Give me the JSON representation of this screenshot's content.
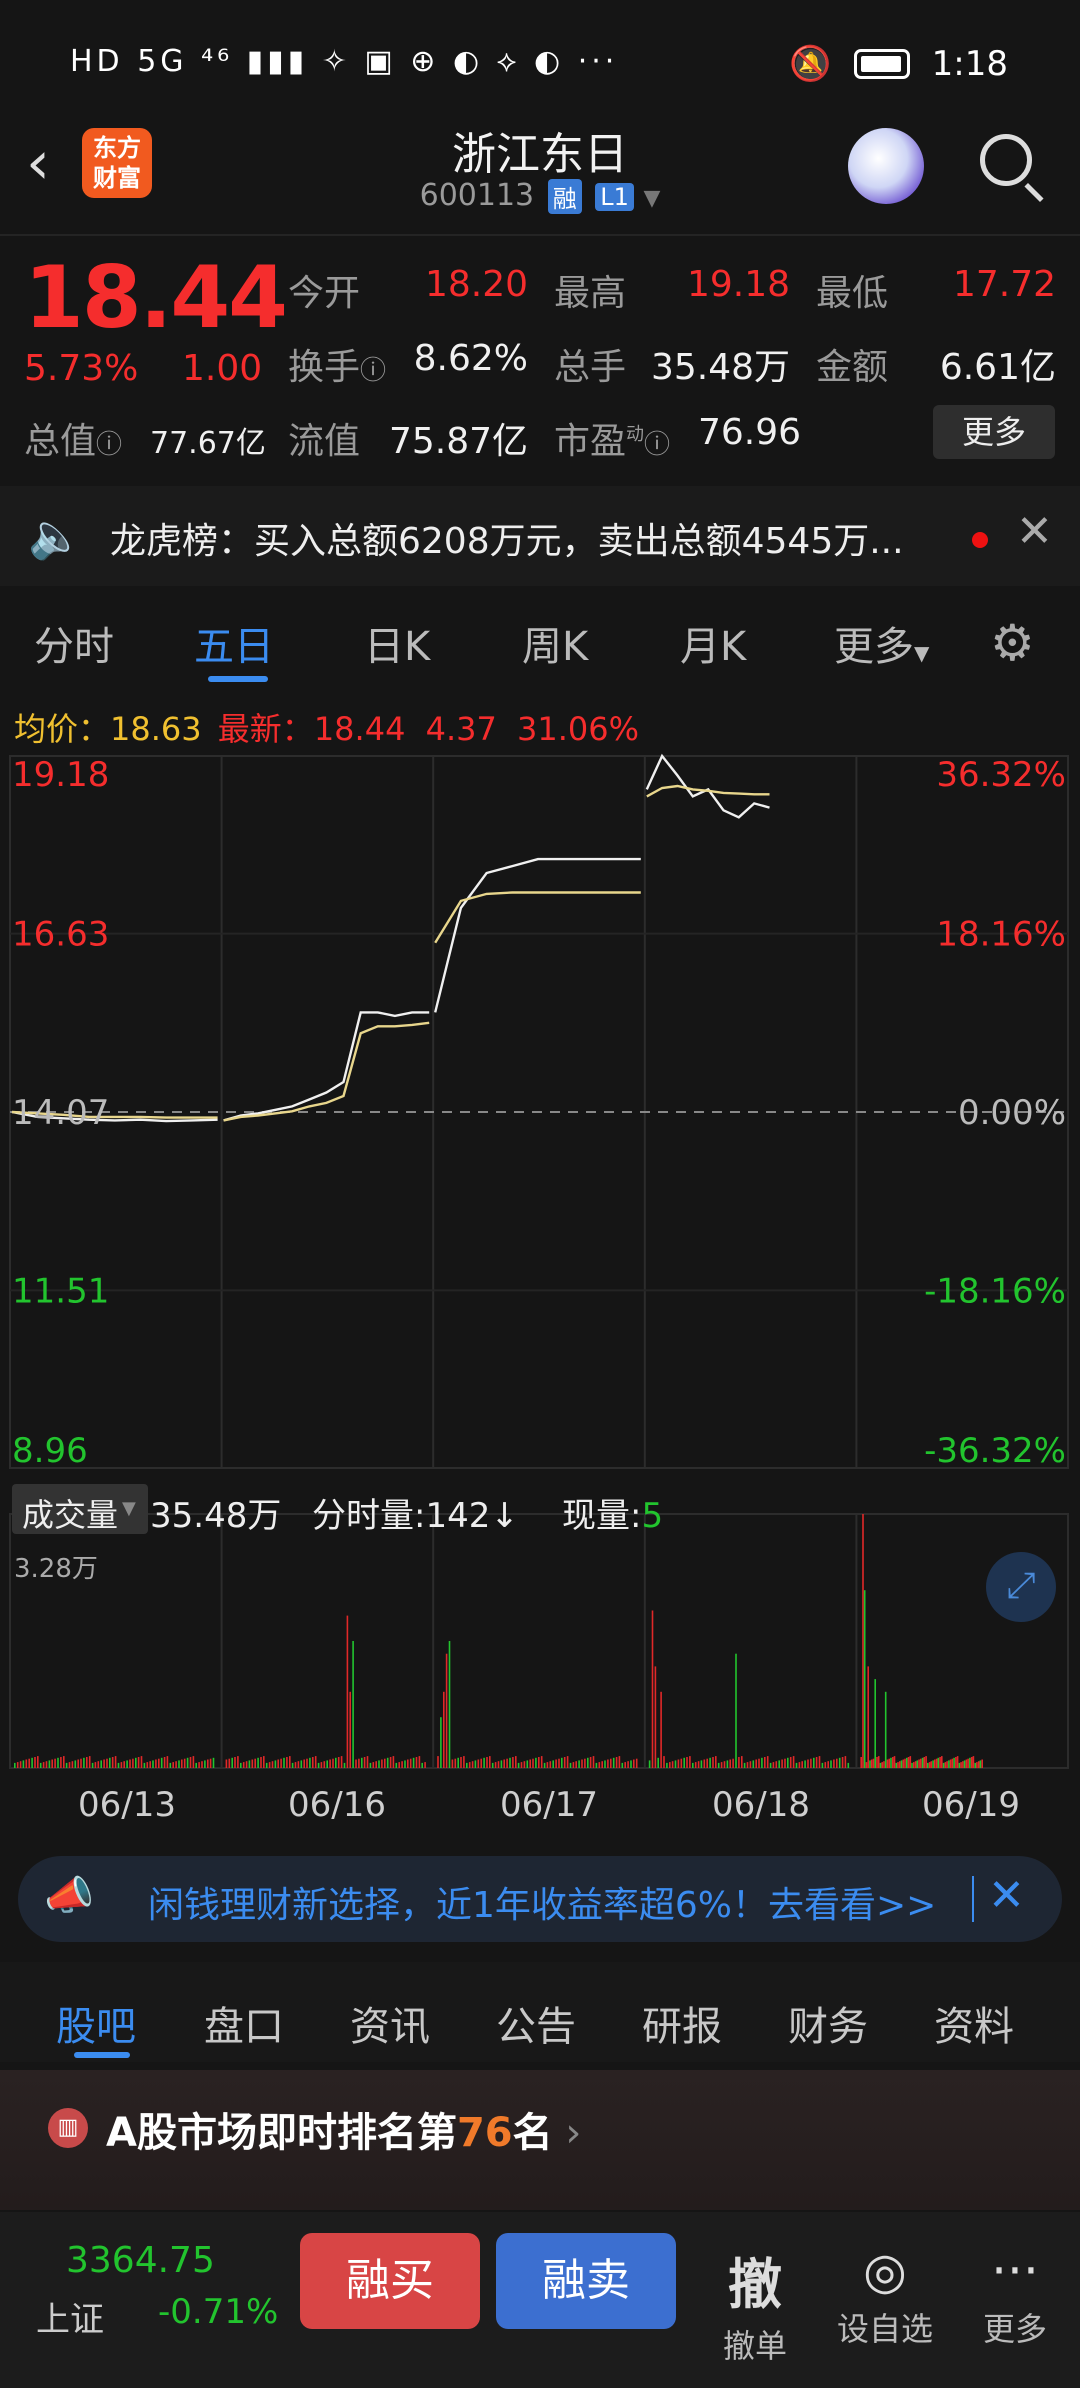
{
  "status": {
    "left": "HD 5G ⁴⁶ ▮▮▮ ✧ ▣ ⊕ ◐ ⟡ ◐ ···",
    "time": "1:18"
  },
  "header": {
    "logo_line1": "东方",
    "logo_line2": "财富",
    "title": "浙江东日",
    "code": "600113",
    "tag1": "融",
    "tag2": "L1"
  },
  "quote": {
    "price": "18.44",
    "pct": "5.73%",
    "change": "1.00",
    "open_label": "今开",
    "open": "18.20",
    "high_label": "最高",
    "high": "19.18",
    "low_label": "最低",
    "low": "17.72",
    "turnover_label": "换手",
    "turnover": "8.62%",
    "volume_label": "总手",
    "volume": "35.48万",
    "amount_label": "金额",
    "amount": "6.61亿",
    "mktcap_label": "总值",
    "mktcap": "77.67亿",
    "float_label": "流值",
    "float": "75.87亿",
    "pe_label": "市盈",
    "pe_sup": "动",
    "pe": "76.96",
    "more": "更多"
  },
  "notice": {
    "text": "龙虎榜：买入总额6208万元，卖出总额4545万..."
  },
  "chart_tabs": [
    "分时",
    "五日",
    "日K",
    "周K",
    "月K",
    "更多"
  ],
  "legend": {
    "avg_label": "均价：",
    "avg": "18.63",
    "last_label": "最新：",
    "last": "18.44",
    "chg": "4.37",
    "pct": "31.06%"
  },
  "chart_data": {
    "type": "line",
    "y_left_ticks": [
      "19.18",
      "16.63",
      "14.07",
      "11.51",
      "8.96"
    ],
    "y_right_ticks": [
      "36.32%",
      "18.16%",
      "0.00%",
      "-18.16%",
      "-36.32%"
    ],
    "ylim": [
      8.96,
      19.18
    ],
    "baseline": 14.07,
    "x_dates": [
      "06/13",
      "06/16",
      "06/17",
      "06/18",
      "06/19"
    ],
    "series": [
      {
        "name": "",
        "color": "#f0f0f0",
        "days": [
          [
            14.07,
            14.0,
            13.98,
            13.96,
            13.95,
            13.96,
            13.94,
            13.95,
            13.96
          ],
          [
            13.95,
            14.02,
            14.05,
            14.1,
            14.15,
            14.25,
            14.35,
            14.5,
            15.5,
            15.5,
            15.45,
            15.5,
            15.5
          ],
          [
            15.5,
            17.0,
            17.5,
            17.6,
            17.7,
            17.7,
            17.7,
            17.7,
            17.7
          ],
          [
            18.7,
            19.18,
            18.9,
            18.6,
            18.7,
            18.4,
            18.3,
            18.5,
            18.44
          ]
        ]
      },
      {
        "name": "",
        "color": "#e8d68c",
        "days": [
          [
            14.07,
            14.05,
            14.03,
            14.0,
            14.0,
            14.0,
            13.99,
            13.99,
            13.99
          ],
          [
            13.95,
            14.0,
            14.02,
            14.05,
            14.08,
            14.15,
            14.2,
            14.3,
            15.2,
            15.3,
            15.3,
            15.32,
            15.35
          ],
          [
            16.5,
            17.1,
            17.2,
            17.22,
            17.22,
            17.22,
            17.22,
            17.22,
            17.22
          ],
          [
            18.6,
            18.72,
            18.75,
            18.7,
            18.68,
            18.65,
            18.64,
            18.63,
            18.63
          ]
        ]
      }
    ]
  },
  "volume": {
    "label": "成交量",
    "total": "35.48万",
    "minute_label": "分时量:",
    "minute": "142",
    "arrow": "↓",
    "now_label": "现量:",
    "now": "5",
    "max": "3.28万"
  },
  "ad": {
    "text": "闲钱理财新选择，近1年收益率超6%！去看看>>"
  },
  "bottom_tabs": [
    "股吧",
    "盘口",
    "资讯",
    "公告",
    "研报",
    "财务",
    "资料"
  ],
  "rank": {
    "text1": "A股市场即时排名第",
    "num": "76",
    "text2": "名"
  },
  "bottom": {
    "index": "3364.75",
    "index_name": "上证",
    "index_pct": "-0.71%",
    "buy": "融买",
    "sell": "融卖",
    "cancel_icon": "撤",
    "cancel": "撤单",
    "fav": "设自选",
    "more": "更多"
  }
}
